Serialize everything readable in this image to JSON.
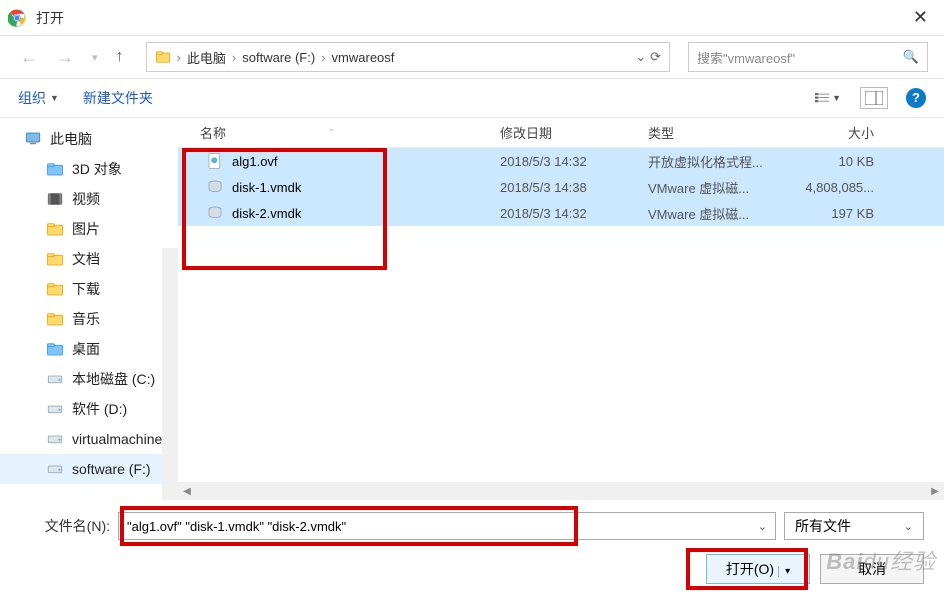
{
  "window": {
    "title": "打开"
  },
  "breadcrumb": {
    "root": "此电脑",
    "drive": "software (F:)",
    "folder": "vmwareosf"
  },
  "search": {
    "placeholder": "搜索\"vmwareosf\""
  },
  "toolbar": {
    "organize": "组织",
    "newfolder": "新建文件夹"
  },
  "tree": {
    "root": "此电脑",
    "items": [
      "3D 对象",
      "视频",
      "图片",
      "文档",
      "下载",
      "音乐",
      "桌面",
      "本地磁盘 (C:)",
      "软件 (D:)",
      "virtualmachine",
      "software (F:)"
    ],
    "selected_index": 10
  },
  "columns": {
    "name": "名称",
    "date": "修改日期",
    "type": "类型",
    "size": "大小"
  },
  "files": [
    {
      "name": "alg1.ovf",
      "date": "2018/5/3 14:32",
      "type": "开放虚拟化格式程...",
      "size": "10 KB",
      "icon": "ovf"
    },
    {
      "name": "disk-1.vmdk",
      "date": "2018/5/3 14:38",
      "type": "VMware 虚拟磁...",
      "size": "4,808,085...",
      "icon": "vmdk"
    },
    {
      "name": "disk-2.vmdk",
      "date": "2018/5/3 14:32",
      "type": "VMware 虚拟磁...",
      "size": "197 KB",
      "icon": "vmdk"
    }
  ],
  "filename": {
    "label": "文件名(N):",
    "value": "\"alg1.ovf\" \"disk-1.vmdk\" \"disk-2.vmdk\""
  },
  "filter": {
    "value": "所有文件"
  },
  "buttons": {
    "open": "打开(O)",
    "cancel": "取消"
  },
  "watermark": {
    "brand": "Bai",
    "brand2": "du",
    "suffix": "经验"
  }
}
